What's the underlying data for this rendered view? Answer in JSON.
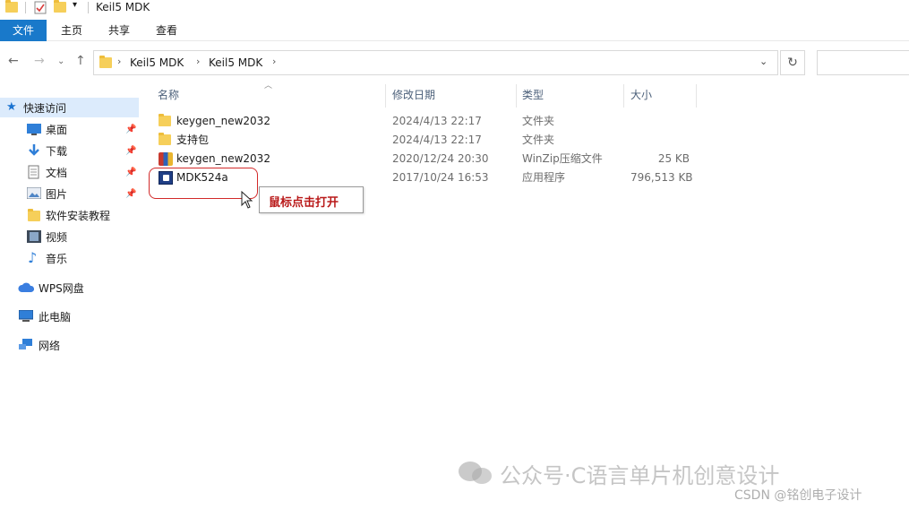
{
  "window": {
    "title": "Keil5 MDK"
  },
  "ribbon": {
    "tabs": [
      "文件",
      "主页",
      "共享",
      "查看"
    ]
  },
  "address": {
    "crumbs": [
      "Keil5 MDK",
      "Keil5 MDK"
    ]
  },
  "nav": {
    "quick_access": "快速访问",
    "items": [
      {
        "label": "桌面",
        "icon": "desktop-icon",
        "pinned": true
      },
      {
        "label": "下载",
        "icon": "download-icon",
        "pinned": true
      },
      {
        "label": "文档",
        "icon": "document-icon",
        "pinned": true
      },
      {
        "label": "图片",
        "icon": "picture-icon",
        "pinned": true
      },
      {
        "label": "软件安装教程",
        "icon": "folder-icon",
        "pinned": false
      },
      {
        "label": "视频",
        "icon": "video-icon",
        "pinned": false
      },
      {
        "label": "音乐",
        "icon": "music-icon",
        "pinned": false
      }
    ],
    "wps": "WPS网盘",
    "this_pc": "此电脑",
    "network": "网络"
  },
  "columns": {
    "name": "名称",
    "modified": "修改日期",
    "type": "类型",
    "size": "大小"
  },
  "files": [
    {
      "name": "keygen_new2032",
      "modified": "2024/4/13 22:17",
      "type": "文件夹",
      "size": "",
      "icon": "folder-icon"
    },
    {
      "name": "支持包",
      "modified": "2024/4/13 22:17",
      "type": "文件夹",
      "size": "",
      "icon": "folder-icon"
    },
    {
      "name": "keygen_new2032",
      "modified": "2020/12/24 20:30",
      "type": "WinZip压缩文件",
      "size": "25 KB",
      "icon": "zip-icon"
    },
    {
      "name": "MDK524a",
      "modified": "2017/10/24 16:53",
      "type": "应用程序",
      "size": "796,513 KB",
      "icon": "exe-icon"
    }
  ],
  "annotation": {
    "tooltip": "鼠标点击打开"
  },
  "watermark": {
    "main": "公众号·C语言单片机创意设计",
    "csdn": "CSDN @铭创电子设计"
  },
  "colors": {
    "accent": "#1979ca",
    "highlight": "#d22a2a",
    "tooltip_text": "#b91919",
    "selection": "#dcebfc"
  }
}
